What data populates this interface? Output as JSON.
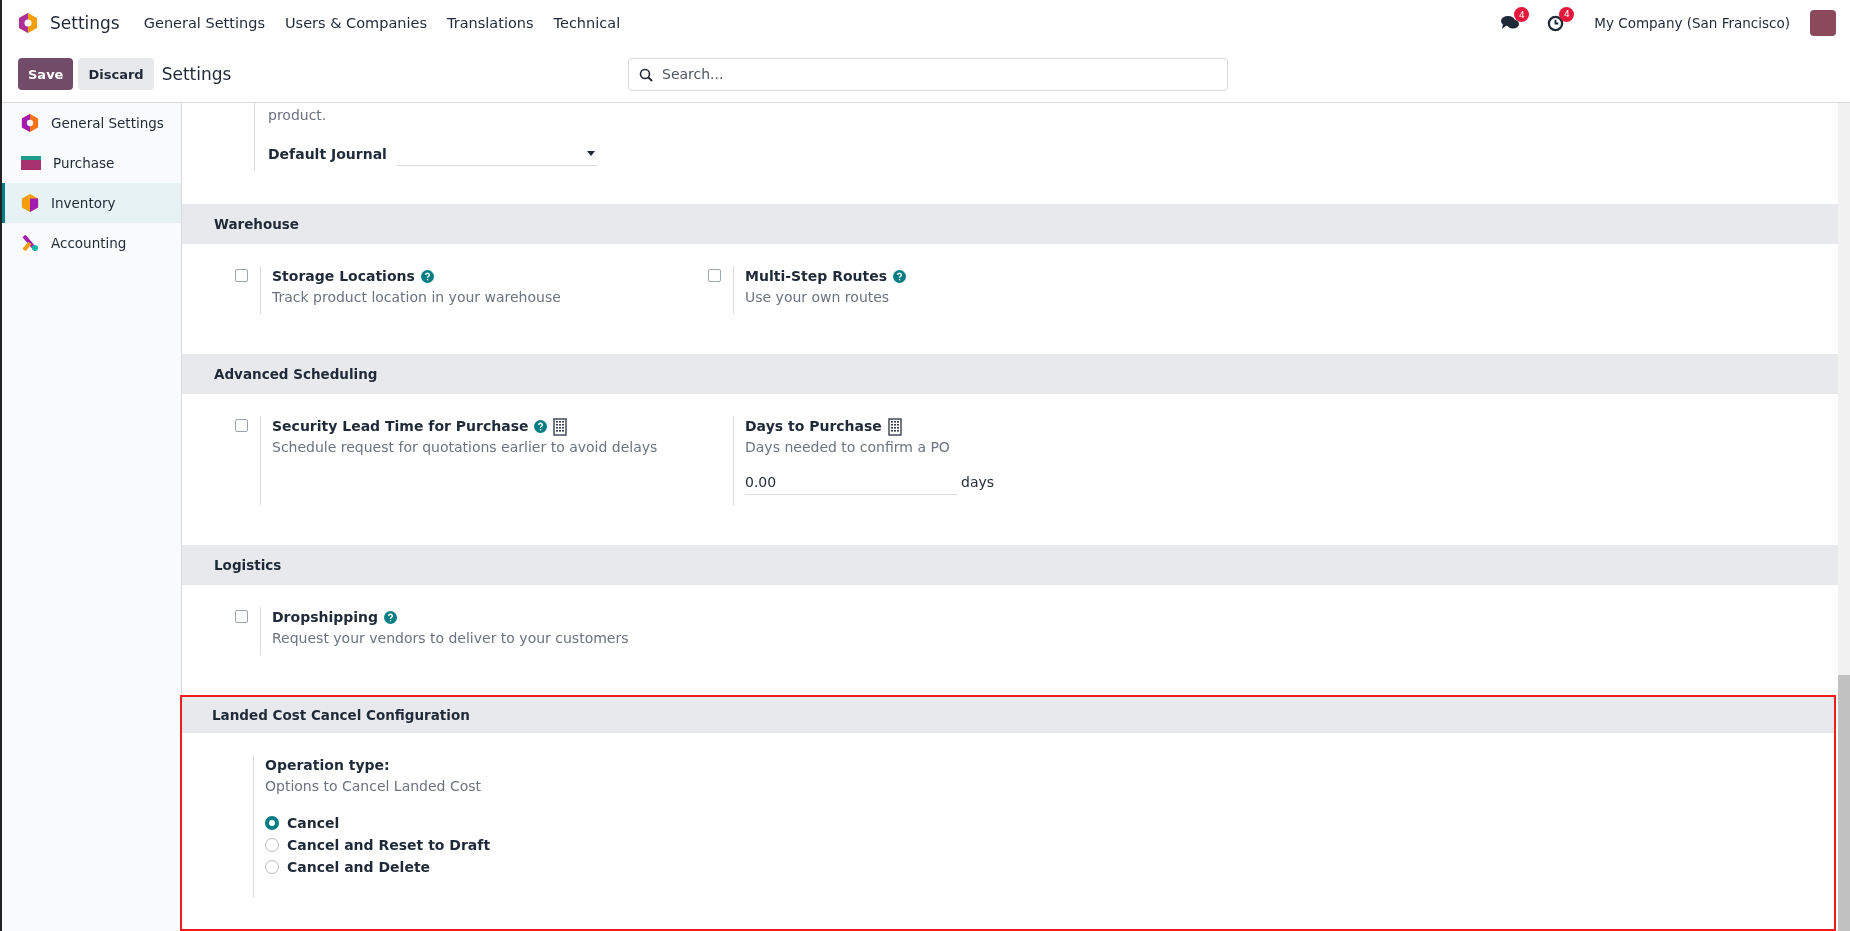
{
  "nav": {
    "app": "Settings",
    "menu": [
      "General Settings",
      "Users & Companies",
      "Translations",
      "Technical"
    ],
    "messages_count": "4",
    "activities_count": "4",
    "company": "My Company (San Francisco)"
  },
  "control_bar": {
    "buttons": [
      "Save",
      "Discard"
    ],
    "breadcrumb": "Settings",
    "search": {
      "placeholder": "Search..."
    }
  },
  "sidebar": {
    "items": [
      {
        "label": "General Settings",
        "selected": false
      },
      {
        "label": "Purchase",
        "selected": false
      },
      {
        "label": "Inventory",
        "selected": true
      },
      {
        "label": "Accounting",
        "selected": false
      }
    ]
  },
  "top_fragment": {
    "description_tail": "product.",
    "field_label": "Default Journal"
  },
  "sections": [
    {
      "title": "Warehouse",
      "highlighted": false,
      "settings": [
        {
          "kind": "checkbox",
          "label": "Storage Locations",
          "help": true,
          "company_specific": false,
          "checked": false,
          "description": "Track product location in your warehouse"
        },
        {
          "kind": "checkbox",
          "label": "Multi-Step Routes",
          "help": true,
          "company_specific": false,
          "checked": false,
          "description": "Use your own routes"
        }
      ]
    },
    {
      "title": "Advanced Scheduling",
      "highlighted": false,
      "settings": [
        {
          "kind": "checkbox",
          "label": "Security Lead Time for Purchase",
          "help": true,
          "company_specific": true,
          "checked": false,
          "description": "Schedule request for quotations earlier to avoid delays"
        },
        {
          "kind": "number",
          "label": "Days to Purchase",
          "help": false,
          "company_specific": true,
          "description": "Days needed to confirm a PO",
          "value": "0.00",
          "unit": "days"
        }
      ]
    },
    {
      "title": "Logistics",
      "highlighted": false,
      "settings": [
        {
          "kind": "checkbox",
          "label": "Dropshipping",
          "help": true,
          "company_specific": false,
          "checked": false,
          "description": "Request your vendors to deliver to your customers"
        }
      ]
    },
    {
      "title": "Landed Cost Cancel Configuration",
      "highlighted": true,
      "settings": [
        {
          "kind": "radio",
          "label": "Operation type:",
          "help": false,
          "company_specific": false,
          "description": "Options to Cancel Landed Cost",
          "options": [
            {
              "label": "Cancel",
              "selected": true
            },
            {
              "label": "Cancel and Reset to Draft",
              "selected": false
            },
            {
              "label": "Cancel and Delete",
              "selected": false
            }
          ]
        }
      ]
    }
  ]
}
